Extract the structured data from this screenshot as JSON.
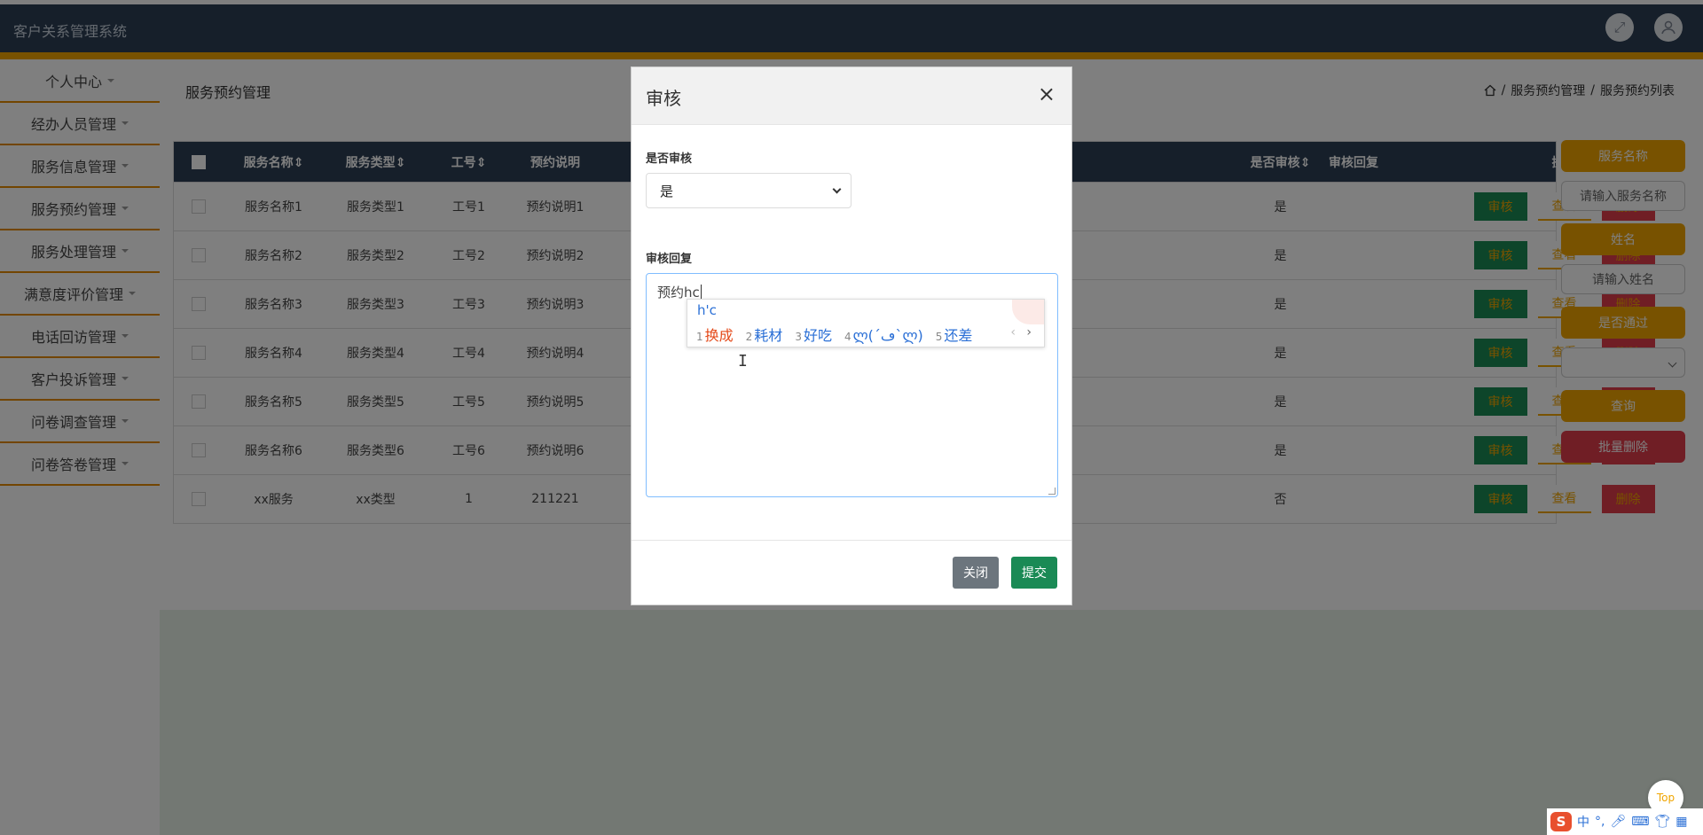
{
  "app": {
    "title": "客户关系管理系统"
  },
  "topbar": {
    "fullscreen_icon": "expand-icon",
    "user_icon": "user-icon"
  },
  "sidebar": {
    "items": [
      {
        "label": "个人中心"
      },
      {
        "label": "经办人员管理"
      },
      {
        "label": "服务信息管理"
      },
      {
        "label": "服务预约管理"
      },
      {
        "label": "服务处理管理"
      },
      {
        "label": "满意度评价管理"
      },
      {
        "label": "电话回访管理"
      },
      {
        "label": "客户投诉管理"
      },
      {
        "label": "问卷调查管理"
      },
      {
        "label": "问卷答卷管理"
      }
    ]
  },
  "page": {
    "title": "服务预约管理",
    "breadcrumb": {
      "home_icon": "home-icon",
      "sep": "/",
      "level1": "服务预约管理",
      "level2": "服务预约列表"
    }
  },
  "table": {
    "headers": {
      "name": "服务名称",
      "type": "服务类型",
      "no": "工号",
      "desc": "预约说明",
      "pass": "是否审核",
      "reply": "审核回复",
      "ops": "操作"
    },
    "rows": [
      {
        "name": "服务名称1",
        "type": "服务类型1",
        "no": "工号1",
        "desc": "预约说明1",
        "pass": "是",
        "reply": ""
      },
      {
        "name": "服务名称2",
        "type": "服务类型2",
        "no": "工号2",
        "desc": "预约说明2",
        "pass": "是",
        "reply": ""
      },
      {
        "name": "服务名称3",
        "type": "服务类型3",
        "no": "工号3",
        "desc": "预约说明3",
        "pass": "是",
        "reply": ""
      },
      {
        "name": "服务名称4",
        "type": "服务类型4",
        "no": "工号4",
        "desc": "预约说明4",
        "pass": "是",
        "reply": ""
      },
      {
        "name": "服务名称5",
        "type": "服务类型5",
        "no": "工号5",
        "desc": "预约说明5",
        "pass": "是",
        "reply": ""
      },
      {
        "name": "服务名称6",
        "type": "服务类型6",
        "no": "工号6",
        "desc": "预约说明6",
        "pass": "是",
        "reply": ""
      },
      {
        "name": "xx服务",
        "type": "xx类型",
        "no": "1",
        "desc": "211221",
        "pass": "否",
        "reply": ""
      }
    ],
    "row_buttons": {
      "audit": "审核",
      "view": "查看",
      "delete": "删除"
    }
  },
  "filter": {
    "name_label": "服务名称",
    "name_placeholder": "请输入服务名称",
    "person_label": "姓名",
    "person_placeholder": "请输入姓名",
    "pass_label": "是否通过",
    "query": "查询",
    "batch_delete": "批量删除"
  },
  "modal": {
    "title": "审核",
    "close_symbol": "×",
    "pass_label": "是否审核",
    "pass_value": "是",
    "reply_label": "审核回复",
    "reply_value": "预约hc",
    "close_button": "关闭",
    "submit_button": "提交"
  },
  "ime": {
    "composition": "h'c",
    "candidates": [
      {
        "num": "1",
        "text": "换成"
      },
      {
        "num": "2",
        "text": "耗材"
      },
      {
        "num": "3",
        "text": "好吃"
      },
      {
        "num": "4",
        "text": "ლ(´ڡ`ლ)"
      },
      {
        "num": "5",
        "text": "还差"
      }
    ],
    "prev": "‹",
    "next": "›"
  },
  "widgets": {
    "top_button": "Top",
    "imebar": {
      "logo": "S",
      "lang": "中",
      "punct": "°,",
      "mic_icon": "mic-icon",
      "keyboard_icon": "keyboard-icon",
      "skin_icon": "shirt-icon",
      "apps_icon": "grid-icon"
    }
  }
}
